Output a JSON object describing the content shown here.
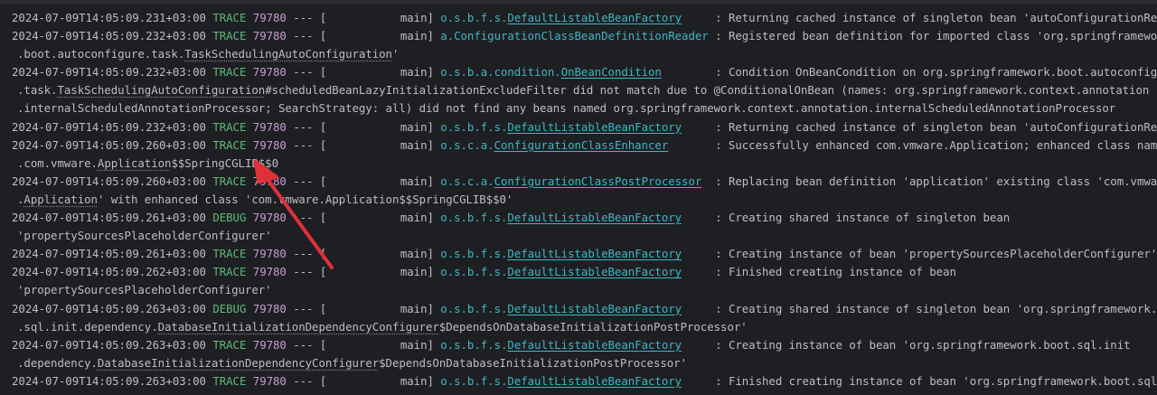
{
  "console": {
    "colors": {
      "background": "#1e1f22",
      "text": "#bcbec4",
      "level": "#5fb87a",
      "pid": "#c99bd3",
      "logger": "#3fb6c5",
      "arrow": "#e0303a"
    },
    "lines": [
      {
        "ts": "2024-07-09T14:05:09.231+03:00",
        "level": "TRACE",
        "pid": "79780",
        "sep": " --- [",
        "thread": "           main] ",
        "logger_pre": "o.s.b.f.s.",
        "logger_link": "DefaultListableBeanFactory",
        "logger_pad": "     ",
        "msg": ": Returning cached instance of singleton bean 'autoConfigurationReport'"
      },
      {
        "ts": "2024-07-09T14:05:09.232+03:00",
        "level": "TRACE",
        "pid": "79780",
        "sep": " --- [",
        "thread": "           main] ",
        "logger_pre": "a.ConfigurationClassBeanDefinitionReader",
        "logger_link": "",
        "logger_pad": " ",
        "msg": ": Registered bean definition for imported class 'org.springframework"
      },
      {
        "cont": ".boot.autoconfigure.task.",
        "cont_dotted": "TaskSchedulingAutoConfiguration",
        "cont_post": "'"
      },
      {
        "ts": "2024-07-09T14:05:09.232+03:00",
        "level": "TRACE",
        "pid": "79780",
        "sep": " --- [",
        "thread": "           main] ",
        "logger_pre": "o.s.b.a.condition.",
        "logger_link": "OnBeanCondition",
        "logger_pad": "        ",
        "msg": ": Condition OnBeanCondition on org.springframework.boot.autoconfigure"
      },
      {
        "cont": ".task.",
        "cont_dotted": "TaskSchedulingAutoConfiguration",
        "cont_post": "#scheduledBeanLazyInitializationExcludeFilter did not match due to @ConditionalOnBean (names: org.springframework.context.annotation"
      },
      {
        "cont": ".internalScheduledAnnotationProcessor; SearchStrategy: all) did not find any beans named org.springframework.context.annotation.internalScheduledAnnotationProcessor",
        "cont_dotted": "",
        "cont_post": ""
      },
      {
        "ts": "2024-07-09T14:05:09.232+03:00",
        "level": "TRACE",
        "pid": "79780",
        "sep": " --- [",
        "thread": "           main] ",
        "logger_pre": "o.s.b.f.s.",
        "logger_link": "DefaultListableBeanFactory",
        "logger_pad": "     ",
        "msg": ": Returning cached instance of singleton bean 'autoConfigurationReport'"
      },
      {
        "ts": "2024-07-09T14:05:09.260+03:00",
        "level": "TRACE",
        "pid": "79780",
        "sep": " --- [",
        "thread": "           main] ",
        "logger_pre": "o.s.c.a.",
        "logger_link": "ConfigurationClassEnhancer",
        "logger_pad": "       ",
        "msg": ": Successfully enhanced com.vmware.Application; enhanced class name is: ↗"
      },
      {
        "cont": ".com.vmware.",
        "cont_dotted": "Application",
        "cont_post": "$$SpringCGLIB$$0"
      },
      {
        "ts": "2024-07-09T14:05:09.260+03:00",
        "level": "TRACE",
        "pid": "79780",
        "sep": " --- [",
        "thread": "           main] ",
        "logger_pre": "o.s.c.a.",
        "logger_link": "ConfigurationClassPostProcessor",
        "logger_pad": "  ",
        "msg": ": Replacing bean definition 'application' existing class 'com.vmware"
      },
      {
        "cont": ".",
        "cont_dotted": "Application",
        "cont_post": "' with enhanced class 'com.vmware.Application$$SpringCGLIB$$0'"
      },
      {
        "ts": "2024-07-09T14:05:09.261+03:00",
        "level": "DEBUG",
        "pid": "79780",
        "sep": " --- [",
        "thread": "           main] ",
        "logger_pre": "o.s.b.f.s.",
        "logger_link": "DefaultListableBeanFactory",
        "logger_pad": "     ",
        "msg": ": Creating shared instance of singleton bean"
      },
      {
        "cont": "'propertySourcesPlaceholderConfigurer'",
        "cont_dotted": "",
        "cont_post": ""
      },
      {
        "ts": "2024-07-09T14:05:09.261+03:00",
        "level": "TRACE",
        "pid": "79780",
        "sep": " --- [",
        "thread": "           main] ",
        "logger_pre": "o.s.b.f.s.",
        "logger_link": "DefaultListableBeanFactory",
        "logger_pad": "     ",
        "msg": ": Creating instance of bean 'propertySourcesPlaceholderConfigurer'"
      },
      {
        "ts": "2024-07-09T14:05:09.262+03:00",
        "level": "TRACE",
        "pid": "79780",
        "sep": " --- [",
        "thread": "           main] ",
        "logger_pre": "o.s.b.f.s.",
        "logger_link": "DefaultListableBeanFactory",
        "logger_pad": "     ",
        "msg": ": Finished creating instance of bean"
      },
      {
        "cont": "'propertySourcesPlaceholderConfigurer'",
        "cont_dotted": "",
        "cont_post": ""
      },
      {
        "ts": "2024-07-09T14:05:09.263+03:00",
        "level": "DEBUG",
        "pid": "79780",
        "sep": " --- [",
        "thread": "           main] ",
        "logger_pre": "o.s.b.f.s.",
        "logger_link": "DefaultListableBeanFactory",
        "logger_pad": "     ",
        "msg": ": Creating shared instance of singleton bean 'org.springframework.boot"
      },
      {
        "cont": ".sql.init.dependency.",
        "cont_dotted": "DatabaseInitializationDependencyConfigurer",
        "cont_post": "$DependsOnDatabaseInitializationPostProcessor'"
      },
      {
        "ts": "2024-07-09T14:05:09.263+03:00",
        "level": "TRACE",
        "pid": "79780",
        "sep": " --- [",
        "thread": "           main] ",
        "logger_pre": "o.s.b.f.s.",
        "logger_link": "DefaultListableBeanFactory",
        "logger_pad": "     ",
        "msg": ": Creating instance of bean 'org.springframework.boot.sql.init"
      },
      {
        "cont": ".dependency.",
        "cont_dotted": "DatabaseInitializationDependencyConfigurer",
        "cont_post": "$DependsOnDatabaseInitializationPostProcessor'"
      },
      {
        "ts": "2024-07-09T14:05:09.263+03:00",
        "level": "TRACE",
        "pid": "79780",
        "sep": " --- [",
        "thread": "           main] ",
        "logger_pre": "o.s.b.f.s.",
        "logger_link": "DefaultListableBeanFactory",
        "logger_pad": "     ",
        "msg": ": Finished creating instance of bean 'org.springframework.boot.sql.init"
      }
    ]
  }
}
